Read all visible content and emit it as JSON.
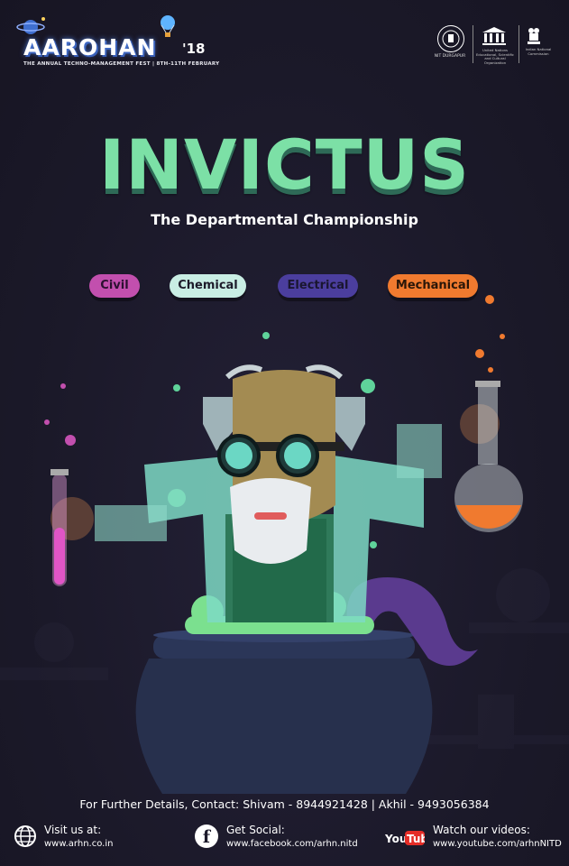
{
  "header": {
    "brand": "AAROHAN",
    "year": "'18",
    "tagline": "THE ANNUAL TECHNO-MANAGEMENT FEST | 8TH-11TH FEBRUARY",
    "logos": {
      "nit_label": "NIT DURGAPUR",
      "unesco_label": "United Nations Educational, Scientific and Cultural Organization",
      "emblem_label": "Indian National Commission"
    }
  },
  "title": "INVICTUS",
  "subtitle": "The Departmental Championship",
  "departments": [
    {
      "label": "Civil",
      "color": "#c24fae"
    },
    {
      "label": "Chemical",
      "color": "#c9eee4"
    },
    {
      "label": "Electrical",
      "color": "#4b3e9e"
    },
    {
      "label": "Mechanical",
      "color": "#f07a2f"
    }
  ],
  "contact": "For Further Details, Contact: Shivam - 8944921428  |  Akhil - 9493056384",
  "footer": {
    "visit": {
      "label": "Visit us at:",
      "url": "www.arhn.co.in",
      "icon": "globe-icon"
    },
    "social": {
      "label": "Get Social:",
      "url": "www.facebook.com/arhn.nitd",
      "icon": "facebook-icon"
    },
    "videos": {
      "label": "Watch our videos:",
      "url": "www.youtube.com/arhnNITD",
      "icon": "youtube-icon"
    }
  },
  "colors": {
    "background": "#1c1a2b",
    "title": "#7ce0a6",
    "accent_green": "#5fd39a"
  }
}
